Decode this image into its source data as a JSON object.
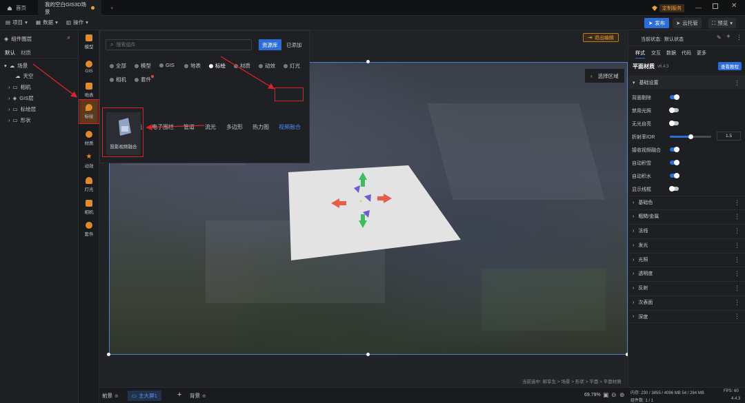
{
  "titlebar": {
    "tabs": [
      {
        "label": "首页"
      },
      {
        "label": "我的空白GIS3D场景"
      }
    ],
    "custom_service": "定制服务",
    "colors": {
      "bg": "#111214",
      "unsaved_dot": "#e8a13a"
    }
  },
  "toolbar": {
    "menus": [
      {
        "label": "项目"
      },
      {
        "label": "数据"
      },
      {
        "label": "操作"
      }
    ],
    "publish": "发布",
    "cloud_host": "云托管",
    "preview": "预览"
  },
  "layers": {
    "title": "组件图层",
    "tabs": [
      {
        "label": "默认"
      },
      {
        "label": "材质"
      }
    ],
    "tree": [
      {
        "label": "场景",
        "expanded": true
      },
      {
        "label": "天空"
      },
      {
        "label": "相机"
      },
      {
        "label": "GIS层"
      },
      {
        "label": "标绘层"
      },
      {
        "label": "形状"
      }
    ]
  },
  "rail": {
    "items": [
      {
        "label": "模型",
        "icon": "cube-icon"
      },
      {
        "label": "GIS",
        "icon": "globe-icon"
      },
      {
        "label": "地表",
        "icon": "terrain-icon"
      },
      {
        "label": "标绘",
        "icon": "marker-icon"
      },
      {
        "label": "材质",
        "icon": "material-icon"
      },
      {
        "label": "动效",
        "icon": "star-icon"
      },
      {
        "label": "灯光",
        "icon": "light-icon"
      },
      {
        "label": "相机",
        "icon": "camera-icon"
      },
      {
        "label": "套件",
        "icon": "kit-icon"
      }
    ]
  },
  "popup": {
    "search_placeholder": "搜索组件",
    "library_btn": "资源库",
    "added_btn": "已添加",
    "categories": [
      {
        "label": "全部"
      },
      {
        "label": "模型"
      },
      {
        "label": "GIS"
      },
      {
        "label": "地表"
      },
      {
        "label": "标绘"
      },
      {
        "label": "材质"
      },
      {
        "label": "动效"
      },
      {
        "label": "灯光"
      },
      {
        "label": "相机"
      },
      {
        "label": "套件"
      }
    ],
    "subtabs": [
      {
        "label": "标记"
      },
      {
        "label": "飞线"
      },
      {
        "label": "电子围栏"
      },
      {
        "label": "管道"
      },
      {
        "label": "流光"
      },
      {
        "label": "多边形"
      },
      {
        "label": "热力图"
      },
      {
        "label": "视频融合"
      }
    ],
    "card_label": "投影视频融合"
  },
  "viewport": {
    "exit_edit": "退出编辑",
    "select_area": "选择区域",
    "breadcrumb": "当前选中: 邮孪生 > 场景 > 形状 > 平面 > 平面材质"
  },
  "rpanel": {
    "status_label": "当前状态:",
    "status_value": "默认状态",
    "tabs": [
      {
        "label": "样式"
      },
      {
        "label": "交互"
      },
      {
        "label": "数据"
      },
      {
        "label": "代码"
      },
      {
        "label": "更多"
      }
    ],
    "component_name": "平面材质",
    "version": "v6.4.3",
    "tutorial": "查看教程",
    "basic_section": "基础设置",
    "props": [
      {
        "label": "背面剔除",
        "on": true
      },
      {
        "label": "禁用光照",
        "on": false
      },
      {
        "label": "无光自亮",
        "on": false
      },
      {
        "label": "折射率IOR",
        "slider": true,
        "value": "1.5"
      },
      {
        "label": "接收视频融合",
        "on": true
      },
      {
        "label": "自动积雪",
        "on": true
      },
      {
        "label": "自动积水",
        "on": true
      },
      {
        "label": "显示线框",
        "on": false
      }
    ],
    "sections": [
      {
        "label": "基础色"
      },
      {
        "label": "粗糙/金属"
      },
      {
        "label": "法线"
      },
      {
        "label": "发光"
      },
      {
        "label": "光照"
      },
      {
        "label": "透明度"
      },
      {
        "label": "反射"
      },
      {
        "label": "次表面"
      },
      {
        "label": "深度"
      }
    ],
    "colors": {
      "accent": "#2c6ed6"
    }
  },
  "bottom": {
    "scenes": [
      {
        "label": "前景"
      },
      {
        "label": "主大屏1"
      },
      {
        "label": "背景"
      }
    ],
    "zoom": "69.79%",
    "memory": "内存: 230 / 3855 / 4096 MB 54 / 284 MB",
    "fps": "FPS: 60",
    "component_count": "组件数: 1 / 1",
    "app_version": "4.4.3"
  }
}
